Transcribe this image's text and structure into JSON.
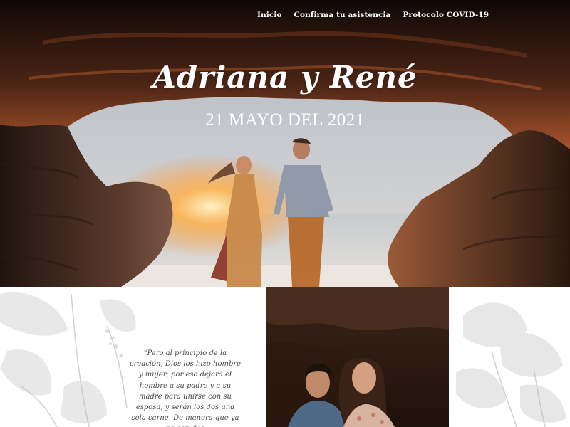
{
  "nav": {
    "items": [
      {
        "label": "Inicio"
      },
      {
        "label": "Confirma tu asistencia"
      },
      {
        "label": "Protocolo COVID-19"
      }
    ]
  },
  "hero": {
    "title": "Adriana y René",
    "date": "21 MAYO DEL 2021"
  },
  "quote": {
    "text": "\"Pero al principio de la creación, Dios los hizo hombre y mujer; por eso dejará el hombre a su padre y a su madre para unirse con su esposa, y serán los dos una sola carne. De manera que ya no son dos"
  },
  "colors": {
    "cave_dark": "#1a0e09",
    "cave_glow": "#b5532a",
    "sky": "#b9c0c7",
    "sand": "#e9e5e0",
    "quote_text": "#4a4a4a"
  }
}
